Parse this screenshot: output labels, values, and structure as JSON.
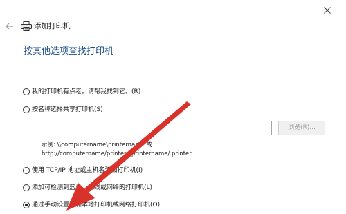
{
  "window": {
    "title": "添加打印机",
    "close_icon": "close-icon",
    "back_icon": "back-arrow-icon",
    "printer_icon": "printer-icon"
  },
  "heading": "按其他选项查找打印机",
  "options": [
    {
      "label": "我的打印机有点老。请帮我找到它。(R)",
      "checked": false
    },
    {
      "label": "按名称选择共享打印机(S)",
      "checked": false
    },
    {
      "label": "使用 TCP/IP 地址或主机名添加打印机(I)",
      "checked": false
    },
    {
      "label": "添加可检测到蓝牙、无线或网络的打印机(L)",
      "checked": false
    },
    {
      "label": "通过手动设置添加本地打印机或网络打印机(O)",
      "checked": true
    }
  ],
  "share_name": {
    "value": "",
    "browse_label": "浏览(R)...",
    "example_line1": "示例: \\\\computername\\printername 或",
    "example_line2": "http://computername/printers/printername/.printer"
  },
  "colors": {
    "heading": "#1b4f8f",
    "arrow": "#d9322b"
  }
}
